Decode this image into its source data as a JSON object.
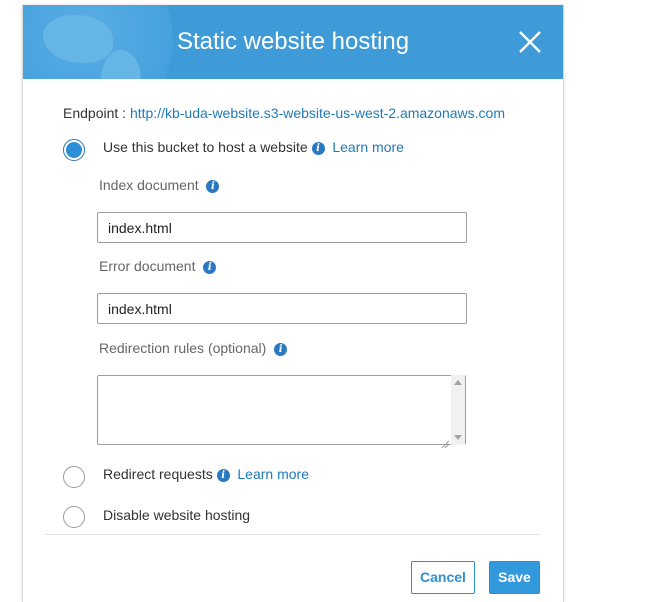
{
  "dialog": {
    "title": "Static website hosting"
  },
  "endpoint": {
    "label": "Endpoint :",
    "url": "http://kb-uda-website.s3-website-us-west-2.amazonaws.com"
  },
  "options": {
    "host": {
      "label": "Use this bucket to host a website",
      "learn_more": "Learn more",
      "selected": true
    },
    "redirect": {
      "label": "Redirect requests",
      "learn_more": "Learn more",
      "selected": false
    },
    "disable": {
      "label": "Disable website hosting",
      "selected": false
    }
  },
  "fields": {
    "index_document": {
      "label": "Index document",
      "value": "index.html"
    },
    "error_document": {
      "label": "Error document",
      "value": "index.html"
    },
    "redirection_rules": {
      "label": "Redirection rules (optional)",
      "value": ""
    }
  },
  "buttons": {
    "cancel": "Cancel",
    "save": "Save"
  },
  "colors": {
    "header": "#3f9bd8",
    "accent": "#2e8fd6",
    "link": "#1f7ab8"
  }
}
